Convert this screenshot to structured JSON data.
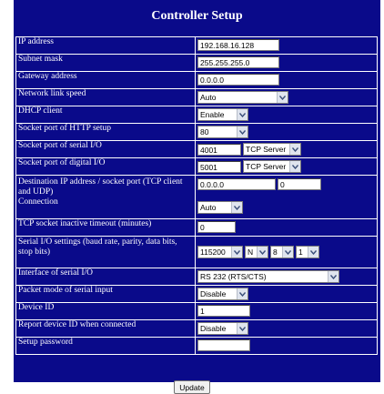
{
  "title": "Controller Setup",
  "fields": {
    "ip_address": {
      "label": "IP address",
      "value": "192.168.16.128"
    },
    "subnet_mask": {
      "label": "Subnet mask",
      "value": "255.255.255.0"
    },
    "gateway": {
      "label": "Gateway address",
      "value": "0.0.0.0"
    },
    "link_speed": {
      "label": "Network link speed",
      "value": "Auto"
    },
    "dhcp": {
      "label": "DHCP client",
      "value": "Enable"
    },
    "http_port": {
      "label": "Socket port of HTTP setup",
      "value": "80"
    },
    "serial_port": {
      "label": "Socket port of serial I/O",
      "value": "4001",
      "mode": "TCP Server"
    },
    "digital_port": {
      "label": "Socket port of digital I/O",
      "value": "5001",
      "mode": "TCP Server"
    },
    "destination": {
      "label": "Destination IP address / socket port (TCP client and UDP)",
      "ip": "0.0.0.0",
      "port": "0",
      "connection_label": "Connection",
      "connection": "Auto"
    },
    "tcp_timeout": {
      "label": "TCP socket inactive timeout (minutes)",
      "value": "0"
    },
    "serial_settings": {
      "label": "Serial I/O settings (baud rate, parity, data bits, stop bits)",
      "baud": "115200",
      "parity": "N",
      "data_bits": "8",
      "stop_bits": "1"
    },
    "serial_interface": {
      "label": "Interface of serial I/O",
      "value": "RS 232 (RTS/CTS)"
    },
    "packet_mode": {
      "label": "Packet mode of serial input",
      "value": "Disable"
    },
    "device_id": {
      "label": "Device ID",
      "value": "1"
    },
    "report_id": {
      "label": "Report device ID when connected",
      "value": "Disable"
    },
    "password": {
      "label": "Setup password",
      "value": ""
    }
  },
  "update_button": "Update",
  "icons": {
    "dropdown": "chevron-down-icon"
  },
  "colors": {
    "background": "#0a0a8a",
    "text": "#ffffff"
  }
}
